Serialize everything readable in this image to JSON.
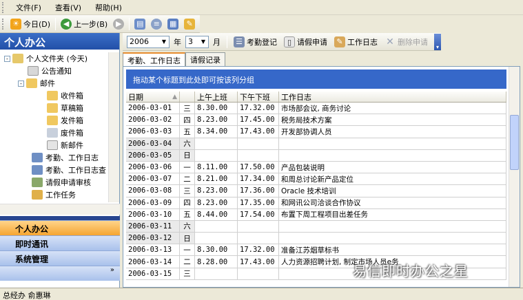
{
  "menu": {
    "items": [
      "文件(F)",
      "查看(V)",
      "帮助(H)"
    ]
  },
  "toolbar1": {
    "today": "今日(D)",
    "back": "上一步(B)"
  },
  "left_panel": {
    "title": "个人办公",
    "tree": [
      {
        "label": "个人文件夹 (今天)",
        "level": 0,
        "expander": "-"
      },
      {
        "label": "公告通知",
        "level": 1
      },
      {
        "label": "邮件",
        "level": 1,
        "expander": "-"
      },
      {
        "label": "收件箱",
        "level": 2
      },
      {
        "label": "草稿箱",
        "level": 2
      },
      {
        "label": "发件箱",
        "level": 2
      },
      {
        "label": "废件箱",
        "level": 2
      },
      {
        "label": "新邮件",
        "level": 2
      },
      {
        "label": "考勤、工作日志",
        "level": 1
      },
      {
        "label": "考勤、工作日志查",
        "level": 1
      },
      {
        "label": "请假申请审核",
        "level": 1
      },
      {
        "label": "工作任务",
        "level": 1
      }
    ],
    "nav": [
      "个人办公",
      "即时通讯",
      "系统管理"
    ],
    "nav_more": "»"
  },
  "toolbar2": {
    "year_value": "2006",
    "year_label": "年",
    "month_value": "3",
    "month_label": "月",
    "buttons": [
      "考勤登记",
      "请假申请",
      "工作日志",
      "删除申请"
    ]
  },
  "tabs": [
    "考勤、工作日志",
    "请假记录"
  ],
  "group_hint": "拖动某个标题到此处即可按该列分组",
  "grid": {
    "headers": [
      "日期",
      "",
      "上午上班",
      "下午下班",
      "工作日志"
    ],
    "rows": [
      [
        "2006-03-01",
        "三",
        "8.30.00",
        "17.32.00",
        "市场部会议, 商务讨论"
      ],
      [
        "2006-03-02",
        "四",
        "8.23.00",
        "17.45.00",
        "税务局技术方案"
      ],
      [
        "2006-03-03",
        "五",
        "8.34.00",
        "17.43.00",
        "开发部协调人员"
      ],
      [
        "2006-03-04",
        "六",
        "",
        "",
        ""
      ],
      [
        "2006-03-05",
        "日",
        "",
        "",
        ""
      ],
      [
        "2006-03-06",
        "一",
        "8.11.00",
        "17.50.00",
        "产品包装说明"
      ],
      [
        "2006-03-07",
        "二",
        "8.21.00",
        "17.34.00",
        "和周总讨论新产品定位"
      ],
      [
        "2006-03-08",
        "三",
        "8.23.00",
        "17.36.00",
        "Oracle 技术培训"
      ],
      [
        "2006-03-09",
        "四",
        "8.23.00",
        "17.35.00",
        "和网讯公司洽谈合作协议"
      ],
      [
        "2006-03-10",
        "五",
        "8.44.00",
        "17.54.00",
        "布置下周工程项目出差任务"
      ],
      [
        "2006-03-11",
        "六",
        "",
        "",
        ""
      ],
      [
        "2006-03-12",
        "日",
        "",
        "",
        ""
      ],
      [
        "2006-03-13",
        "一",
        "8.30.00",
        "17.32.00",
        "准备江苏烟草标书"
      ],
      [
        "2006-03-14",
        "二",
        "8.28.00",
        "17.43.00",
        "人力资源招聘计划, 制定市场人员e务"
      ],
      [
        "2006-03-15",
        "三",
        "",
        "",
        ""
      ]
    ]
  },
  "status": {
    "text": "总经办  俞惠琳"
  },
  "watermark": "易信即时办公之星"
}
